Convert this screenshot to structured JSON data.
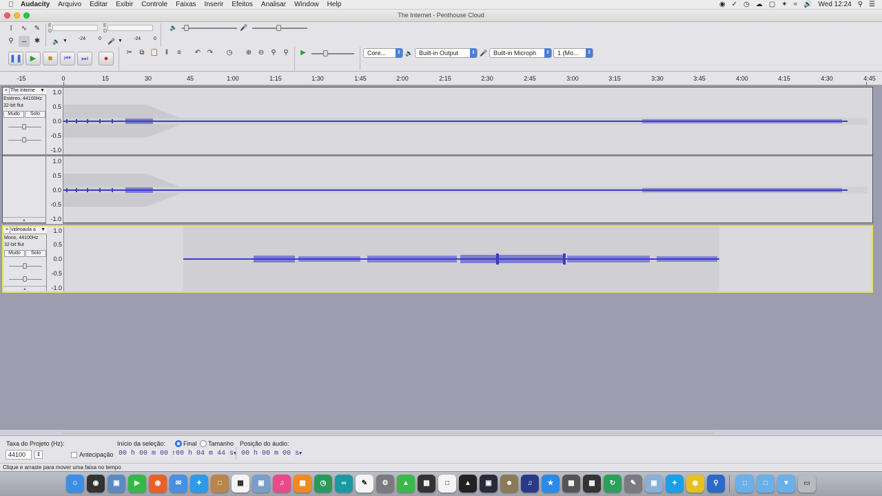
{
  "menubar": {
    "app_name": "Audacity",
    "items": [
      "Arquivo",
      "Editar",
      "Exibir",
      "Controle",
      "Faixas",
      "Inserir",
      "Efeitos",
      "Analisar",
      "Window",
      "Help"
    ],
    "clock": "Wed 12:24"
  },
  "window": {
    "title": "The Internet - Penthouse Cloud"
  },
  "meters": {
    "play_level_left": "-24",
    "play_level_right": "0",
    "rec_level_left": "-24",
    "rec_level_right": "0"
  },
  "devices": {
    "host": "Core...",
    "output": "Built-in Output",
    "input": "Built-in Microph",
    "channels": "1 (Mo..."
  },
  "ruler": {
    "ticks": [
      "-15",
      "0",
      "15",
      "30",
      "45",
      "1:00",
      "1:15",
      "1:30",
      "1:45",
      "2:00",
      "2:15",
      "2:30",
      "2:45",
      "3:00",
      "3:15",
      "3:30",
      "3:45",
      "4:00",
      "4:15",
      "4:30",
      "4:45"
    ]
  },
  "tracks": [
    {
      "name": "The Interne",
      "line1": "Estéreo, 44100Hz",
      "line2": "32-bit flut",
      "mute": "Mudo",
      "solo": "Solo",
      "scale": [
        "1.0",
        "0.5",
        "0.0",
        "-0.5",
        "-1.0"
      ]
    },
    {
      "name": "videoaula a",
      "line1": "Mono, 44100Hz",
      "line2": "32-bit flut",
      "mute": "Mudo",
      "solo": "Solo",
      "scale": [
        "1.0",
        "0.5",
        "0.0",
        "-0.5",
        "-1.0"
      ]
    }
  ],
  "selection_bar": {
    "rate_label": "Taxa do Projeto (Hz):",
    "rate_value": "44100",
    "snap_label": "Antecipação",
    "start_label": "Início da seleção:",
    "end_option": "Final",
    "length_option": "Tamanho",
    "position_label": "Posição do áudio:",
    "start_time": "00 h 00 m 00 s",
    "end_time": "00 h 04 m 44 s",
    "audio_position": "00 h 00 m 00 s"
  },
  "status": {
    "message": "Clique e arraste para mover uma faixa no tempo"
  },
  "colors": {
    "waveform": "#3c3cc8",
    "selection_border": "#e7e060",
    "track_background": "#d9d9de",
    "project_background": "#9c9eb0"
  }
}
